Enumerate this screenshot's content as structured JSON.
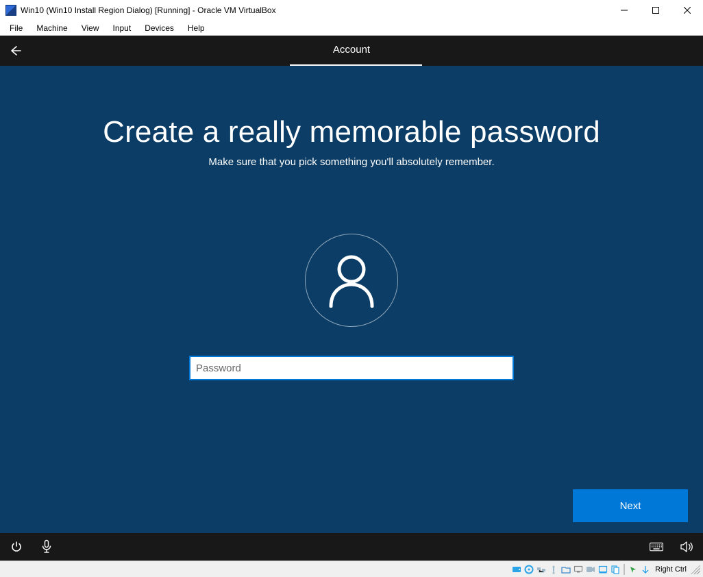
{
  "host": {
    "title": "Win10 (Win10 Install Region Dialog) [Running] - Oracle VM VirtualBox",
    "menus": [
      "File",
      "Machine",
      "View",
      "Input",
      "Devices",
      "Help"
    ],
    "status": {
      "hostkey": "Right Ctrl",
      "icons": [
        "hdd",
        "disc",
        "net",
        "usb",
        "shared-folder",
        "display",
        "record",
        "video-capture",
        "clipboard",
        "drag-drop",
        "mouse-integration",
        "power"
      ]
    }
  },
  "guest": {
    "header_tab": "Account",
    "heading": "Create a really memorable password",
    "subheading": "Make sure that you pick something you'll absolutely remember.",
    "password_placeholder": "Password",
    "password_value": "",
    "next_label": "Next",
    "footer_left_icons": [
      "power",
      "dictation"
    ],
    "footer_right_icons": [
      "keyboard",
      "volume"
    ]
  }
}
